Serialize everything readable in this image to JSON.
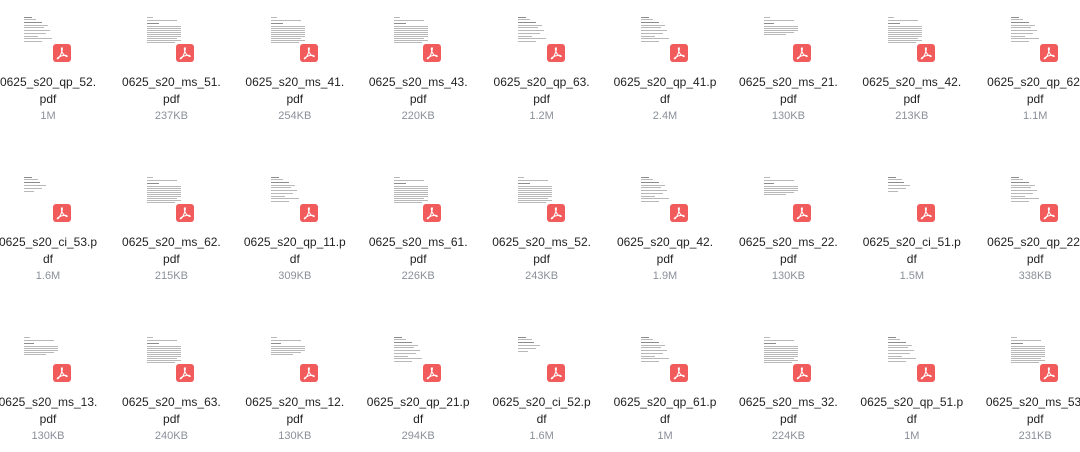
{
  "files": [
    {
      "name": "0625_s20_qp_52.pdf",
      "line1": "0625_s20_qp_52.",
      "line2": "pdf",
      "size": "1M",
      "kind": "qp"
    },
    {
      "name": "0625_s20_ms_51.pdf",
      "line1": "0625_s20_ms_51.",
      "line2": "pdf",
      "size": "237KB",
      "kind": "ms"
    },
    {
      "name": "0625_s20_ms_41.pdf",
      "line1": "0625_s20_ms_41.",
      "line2": "pdf",
      "size": "254KB",
      "kind": "ms"
    },
    {
      "name": "0625_s20_ms_43.pdf",
      "line1": "0625_s20_ms_43.",
      "line2": "pdf",
      "size": "220KB",
      "kind": "ms"
    },
    {
      "name": "0625_s20_qp_63.pdf",
      "line1": "0625_s20_qp_63.",
      "line2": "pdf",
      "size": "1.2M",
      "kind": "qp"
    },
    {
      "name": "0625_s20_qp_41.pdf",
      "line1": "0625_s20_qp_41.p",
      "line2": "df",
      "size": "2.4M",
      "kind": "qp"
    },
    {
      "name": "0625_s20_ms_21.pdf",
      "line1": "0625_s20_ms_21.",
      "line2": "pdf",
      "size": "130KB",
      "kind": "ms2"
    },
    {
      "name": "0625_s20_ms_42.pdf",
      "line1": "0625_s20_ms_42.",
      "line2": "pdf",
      "size": "213KB",
      "kind": "ms"
    },
    {
      "name": "0625_s20_qp_62.pdf",
      "line1": "0625_s20_qp_62.",
      "line2": "pdf",
      "size": "1.1M",
      "kind": "qp"
    },
    {
      "name": "0625_s20_ci_53.pdf",
      "line1": "0625_s20_ci_53.p",
      "line2": "df",
      "size": "1.6M",
      "kind": "ci"
    },
    {
      "name": "0625_s20_ms_62.pdf",
      "line1": "0625_s20_ms_62.",
      "line2": "pdf",
      "size": "215KB",
      "kind": "ms"
    },
    {
      "name": "0625_s20_qp_11.pdf",
      "line1": "0625_s20_qp_11.p",
      "line2": "df",
      "size": "309KB",
      "kind": "qp"
    },
    {
      "name": "0625_s20_ms_61.pdf",
      "line1": "0625_s20_ms_61.",
      "line2": "pdf",
      "size": "226KB",
      "kind": "ms"
    },
    {
      "name": "0625_s20_ms_52.pdf",
      "line1": "0625_s20_ms_52.",
      "line2": "pdf",
      "size": "243KB",
      "kind": "ms"
    },
    {
      "name": "0625_s20_qp_42.pdf",
      "line1": "0625_s20_qp_42.",
      "line2": "pdf",
      "size": "1.9M",
      "kind": "qp"
    },
    {
      "name": "0625_s20_ms_22.pdf",
      "line1": "0625_s20_ms_22.",
      "line2": "pdf",
      "size": "130KB",
      "kind": "ms2"
    },
    {
      "name": "0625_s20_ci_51.pdf",
      "line1": "0625_s20_ci_51.p",
      "line2": "df",
      "size": "1.5M",
      "kind": "ci"
    },
    {
      "name": "0625_s20_qp_22.pdf",
      "line1": "0625_s20_qp_22.",
      "line2": "pdf",
      "size": "338KB",
      "kind": "qp"
    },
    {
      "name": "0625_s20_ms_13.pdf",
      "line1": "0625_s20_ms_13.",
      "line2": "pdf",
      "size": "130KB",
      "kind": "ms2"
    },
    {
      "name": "0625_s20_ms_63.pdf",
      "line1": "0625_s20_ms_63.",
      "line2": "pdf",
      "size": "240KB",
      "kind": "ms"
    },
    {
      "name": "0625_s20_ms_12.pdf",
      "line1": "0625_s20_ms_12.",
      "line2": "pdf",
      "size": "130KB",
      "kind": "ms2"
    },
    {
      "name": "0625_s20_qp_21.pdf",
      "line1": "0625_s20_qp_21.p",
      "line2": "df",
      "size": "294KB",
      "kind": "qp"
    },
    {
      "name": "0625_s20_ci_52.pdf",
      "line1": "0625_s20_ci_52.p",
      "line2": "df",
      "size": "1.6M",
      "kind": "ci"
    },
    {
      "name": "0625_s20_qp_61.pdf",
      "line1": "0625_s20_qp_61.p",
      "line2": "df",
      "size": "1M",
      "kind": "qp"
    },
    {
      "name": "0625_s20_ms_32.pdf",
      "line1": "0625_s20_ms_32.",
      "line2": "pdf",
      "size": "224KB",
      "kind": "ms"
    },
    {
      "name": "0625_s20_qp_51.pdf",
      "line1": "0625_s20_qp_51.p",
      "line2": "df",
      "size": "1M",
      "kind": "qp"
    },
    {
      "name": "0625_s20_ms_53.pdf",
      "line1": "0625_s20_ms_53.",
      "line2": "pdf",
      "size": "231KB",
      "kind": "ms"
    }
  ],
  "icons": {
    "file_type_badge": "pdf-icon",
    "badge_color": "#f25b5b",
    "filename_color": "#1f1f1f",
    "size_color": "#8a8f99"
  }
}
